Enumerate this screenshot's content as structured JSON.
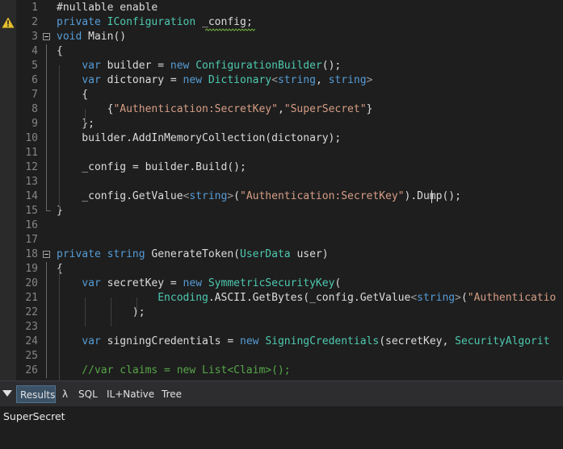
{
  "colors": {
    "keyword": "#569cd6",
    "type": "#4ec9b0",
    "string": "#d69d85",
    "comment": "#57a64a",
    "plain": "#dcdcdc",
    "line_number": "#858585",
    "warning": "#e6c02d"
  },
  "editor": {
    "lines": [
      {
        "n": "1",
        "tokens": [
          [
            "i",
            "#nullable enable"
          ]
        ]
      },
      {
        "n": "2",
        "tokens": [
          [
            "k",
            "private "
          ],
          [
            "t",
            "IConfiguration"
          ],
          [
            "i",
            " _config;"
          ]
        ],
        "warning": true
      },
      {
        "n": "3",
        "tokens": [
          [
            "k",
            "void "
          ],
          [
            "i",
            "Main()"
          ]
        ],
        "fold": "open"
      },
      {
        "n": "4",
        "tokens": [
          [
            "i",
            "{"
          ]
        ]
      },
      {
        "n": "5",
        "tokens": [
          [
            "i",
            "    "
          ],
          [
            "k",
            "var "
          ],
          [
            "i",
            "builder = "
          ],
          [
            "k",
            "new "
          ],
          [
            "t",
            "ConfigurationBuilder"
          ],
          [
            "i",
            "();"
          ]
        ]
      },
      {
        "n": "6",
        "tokens": [
          [
            "i",
            "    "
          ],
          [
            "k",
            "var "
          ],
          [
            "i",
            "dictonary = "
          ],
          [
            "k",
            "new "
          ],
          [
            "t",
            "Dictionary"
          ],
          [
            "p",
            "<"
          ],
          [
            "k",
            "string"
          ],
          [
            "i",
            ", "
          ],
          [
            "k",
            "string"
          ],
          [
            "p",
            ">"
          ]
        ]
      },
      {
        "n": "7",
        "tokens": [
          [
            "i",
            "    {"
          ]
        ]
      },
      {
        "n": "8",
        "tokens": [
          [
            "i",
            "        {"
          ],
          [
            "s",
            "\"Authentication:SecretKey\""
          ],
          [
            "i",
            ","
          ],
          [
            "s",
            "\"SuperSecret\""
          ],
          [
            "i",
            "}"
          ]
        ]
      },
      {
        "n": "9",
        "tokens": [
          [
            "i",
            "    };"
          ]
        ]
      },
      {
        "n": "10",
        "tokens": [
          [
            "i",
            "    builder.AddInMemoryCollection(dictonary);"
          ]
        ]
      },
      {
        "n": "11",
        "tokens": []
      },
      {
        "n": "12",
        "tokens": [
          [
            "i",
            "    _config = builder.Build();"
          ]
        ]
      },
      {
        "n": "13",
        "tokens": []
      },
      {
        "n": "14",
        "tokens": [
          [
            "i",
            "    _config.GetValue"
          ],
          [
            "p",
            "<"
          ],
          [
            "k",
            "string"
          ],
          [
            "p",
            ">"
          ],
          [
            "i",
            "("
          ],
          [
            "s",
            "\"Authentication:SecretKey\""
          ],
          [
            "i",
            ").Dump();"
          ]
        ]
      },
      {
        "n": "15",
        "tokens": [
          [
            "i",
            "}"
          ]
        ],
        "fold": "end"
      },
      {
        "n": "16",
        "tokens": []
      },
      {
        "n": "17",
        "tokens": []
      },
      {
        "n": "18",
        "tokens": [
          [
            "k",
            "private "
          ],
          [
            "k",
            "string "
          ],
          [
            "i",
            "GenerateToken("
          ],
          [
            "t",
            "UserData"
          ],
          [
            "i",
            " user)"
          ]
        ],
        "fold": "open"
      },
      {
        "n": "19",
        "tokens": [
          [
            "i",
            "{"
          ]
        ]
      },
      {
        "n": "20",
        "tokens": [
          [
            "i",
            "    "
          ],
          [
            "k",
            "var "
          ],
          [
            "i",
            "secretKey = "
          ],
          [
            "k",
            "new "
          ],
          [
            "t",
            "SymmetricSecurityKey"
          ],
          [
            "i",
            "("
          ]
        ]
      },
      {
        "n": "21",
        "tokens": [
          [
            "i",
            "                "
          ],
          [
            "t",
            "Encoding"
          ],
          [
            "i",
            ".ASCII.GetBytes(_config.GetValue"
          ],
          [
            "p",
            "<"
          ],
          [
            "k",
            "string"
          ],
          [
            "p",
            ">"
          ],
          [
            "i",
            "("
          ],
          [
            "s",
            "\"Authenticatio"
          ]
        ]
      },
      {
        "n": "22",
        "tokens": [
          [
            "i",
            "            );"
          ]
        ]
      },
      {
        "n": "23",
        "tokens": []
      },
      {
        "n": "24",
        "tokens": [
          [
            "i",
            "    "
          ],
          [
            "k",
            "var "
          ],
          [
            "i",
            "signingCredentials = "
          ],
          [
            "k",
            "new "
          ],
          [
            "t",
            "SigningCredentials"
          ],
          [
            "i",
            "(secretKey, "
          ],
          [
            "t",
            "SecurityAlgorit"
          ]
        ]
      },
      {
        "n": "25",
        "tokens": []
      },
      {
        "n": "26",
        "tokens": [
          [
            "c",
            "    //var claims = new List<Claim>();"
          ]
        ]
      }
    ]
  },
  "results": {
    "tabs": [
      {
        "label": "Results",
        "active": true
      },
      {
        "label": "λ",
        "active": false
      },
      {
        "label": "SQL",
        "active": false
      },
      {
        "label": "IL+Native",
        "active": false
      },
      {
        "label": "Tree",
        "active": false
      }
    ],
    "output": "SuperSecret"
  }
}
